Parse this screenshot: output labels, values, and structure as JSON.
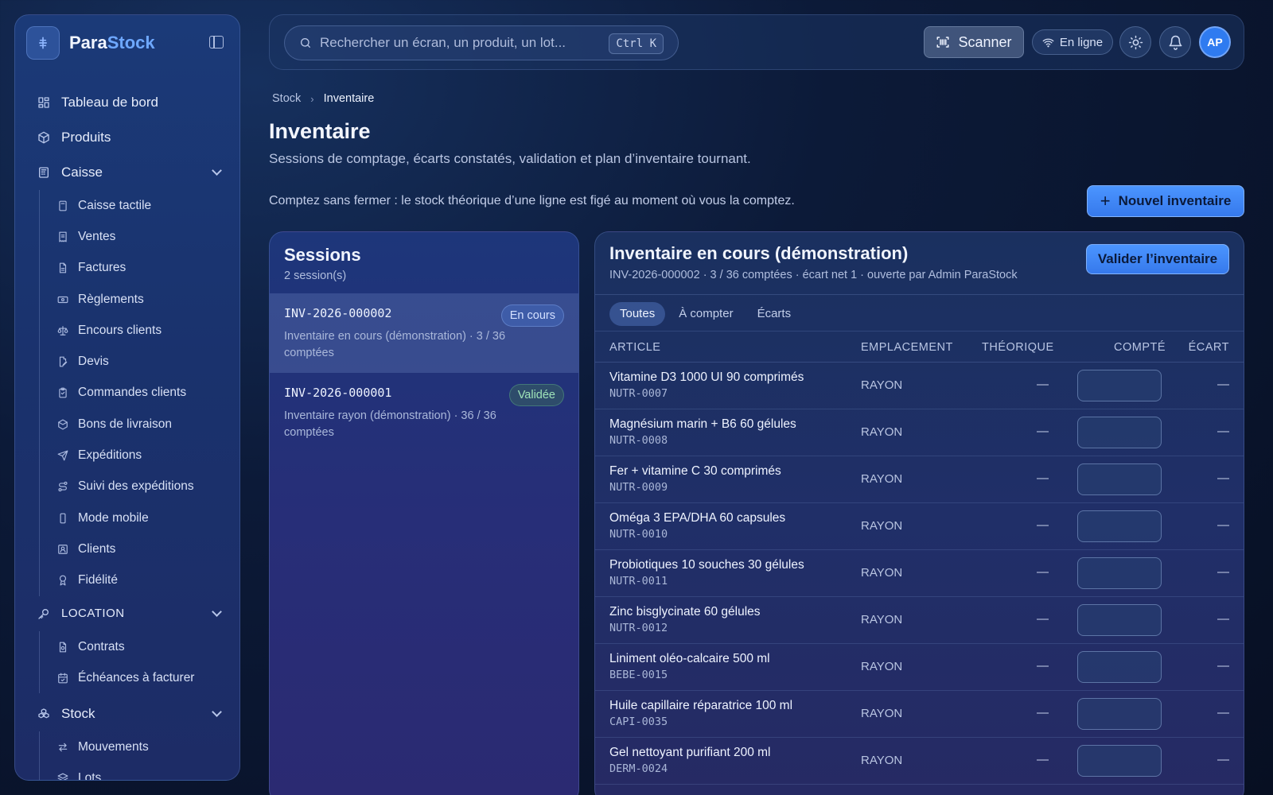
{
  "brand": {
    "name_part1": "Para",
    "name_part2": "Stock"
  },
  "nav": {
    "dashboard": "Tableau de bord",
    "products": "Produits",
    "caisse": "Caisse",
    "caisse_items": [
      "Caisse tactile",
      "Ventes",
      "Factures",
      "Règlements",
      "Encours clients",
      "Devis",
      "Commandes clients",
      "Bons de livraison",
      "Expéditions",
      "Suivi des expéditions",
      "Mode mobile",
      "Clients",
      "Fidélité"
    ],
    "location": "LOCATION",
    "location_items": [
      "Contrats",
      "Échéances à facturer"
    ],
    "stock": "Stock",
    "stock_items": [
      "Mouvements",
      "Lots"
    ]
  },
  "topbar": {
    "search_placeholder": "Rechercher un écran, un produit, un lot...",
    "shortcut": "Ctrl K",
    "scan_label": "Scanner",
    "status_label": "En ligne",
    "avatar_initials": "AP"
  },
  "breadcrumb": {
    "parent": "Stock",
    "current": "Inventaire"
  },
  "page": {
    "title": "Inventaire",
    "subtitle": "Sessions de comptage, écarts constatés, validation et plan d’inventaire tournant.",
    "hint": "Comptez sans fermer : le stock théorique d’une ligne est figé au moment où vous la comptez.",
    "new_button": "Nouvel inventaire"
  },
  "sessions": {
    "title": "Sessions",
    "count": "2 session(s)",
    "items": [
      {
        "id": "INV-2026-000002",
        "status": "En cours",
        "description": "Inventaire en cours (démonstration) · 3 / 36 comptées"
      },
      {
        "id": "INV-2026-000001",
        "status": "Validée",
        "description": "Inventaire rayon (démonstration) · 36 / 36 comptées"
      }
    ]
  },
  "inventory": {
    "title": "Inventaire en cours (démonstration)",
    "meta": "INV-2026-000002 · 3 / 36 comptées · écart net 1 · ouverte par Admin ParaStock",
    "validate_button": "Valider l’inventaire",
    "tabs": [
      "Toutes",
      "À compter",
      "Écarts"
    ],
    "columns": {
      "article": "ARTICLE",
      "location": "EMPLACEMENT",
      "theoretical": "THÉORIQUE",
      "counted": "COMPTÉ",
      "gap": "ÉCART"
    },
    "rows": [
      {
        "name": "Vitamine D3 1000 UI 90 comprimés",
        "code": "NUTR-0007",
        "location": "RAYON",
        "theoretical": "—",
        "gap": "—"
      },
      {
        "name": "Magnésium marin + B6 60 gélules",
        "code": "NUTR-0008",
        "location": "RAYON",
        "theoretical": "—",
        "gap": "—"
      },
      {
        "name": "Fer + vitamine C 30 comprimés",
        "code": "NUTR-0009",
        "location": "RAYON",
        "theoretical": "—",
        "gap": "—"
      },
      {
        "name": "Oméga 3 EPA/DHA 60 capsules",
        "code": "NUTR-0010",
        "location": "RAYON",
        "theoretical": "—",
        "gap": "—"
      },
      {
        "name": "Probiotiques 10 souches 30 gélules",
        "code": "NUTR-0011",
        "location": "RAYON",
        "theoretical": "—",
        "gap": "—"
      },
      {
        "name": "Zinc bisglycinate 60 gélules",
        "code": "NUTR-0012",
        "location": "RAYON",
        "theoretical": "—",
        "gap": "—"
      },
      {
        "name": "Liniment oléo-calcaire 500 ml",
        "code": "BEBE-0015",
        "location": "RAYON",
        "theoretical": "—",
        "gap": "—"
      },
      {
        "name": "Huile capillaire réparatrice 100 ml",
        "code": "CAPI-0035",
        "location": "RAYON",
        "theoretical": "—",
        "gap": "—"
      },
      {
        "name": "Gel nettoyant purifiant 200 ml",
        "code": "DERM-0024",
        "location": "RAYON",
        "theoretical": "—",
        "gap": "—"
      }
    ]
  },
  "colors": {
    "accent": "#3b82f6",
    "badge_green": "#9fe3b8"
  }
}
